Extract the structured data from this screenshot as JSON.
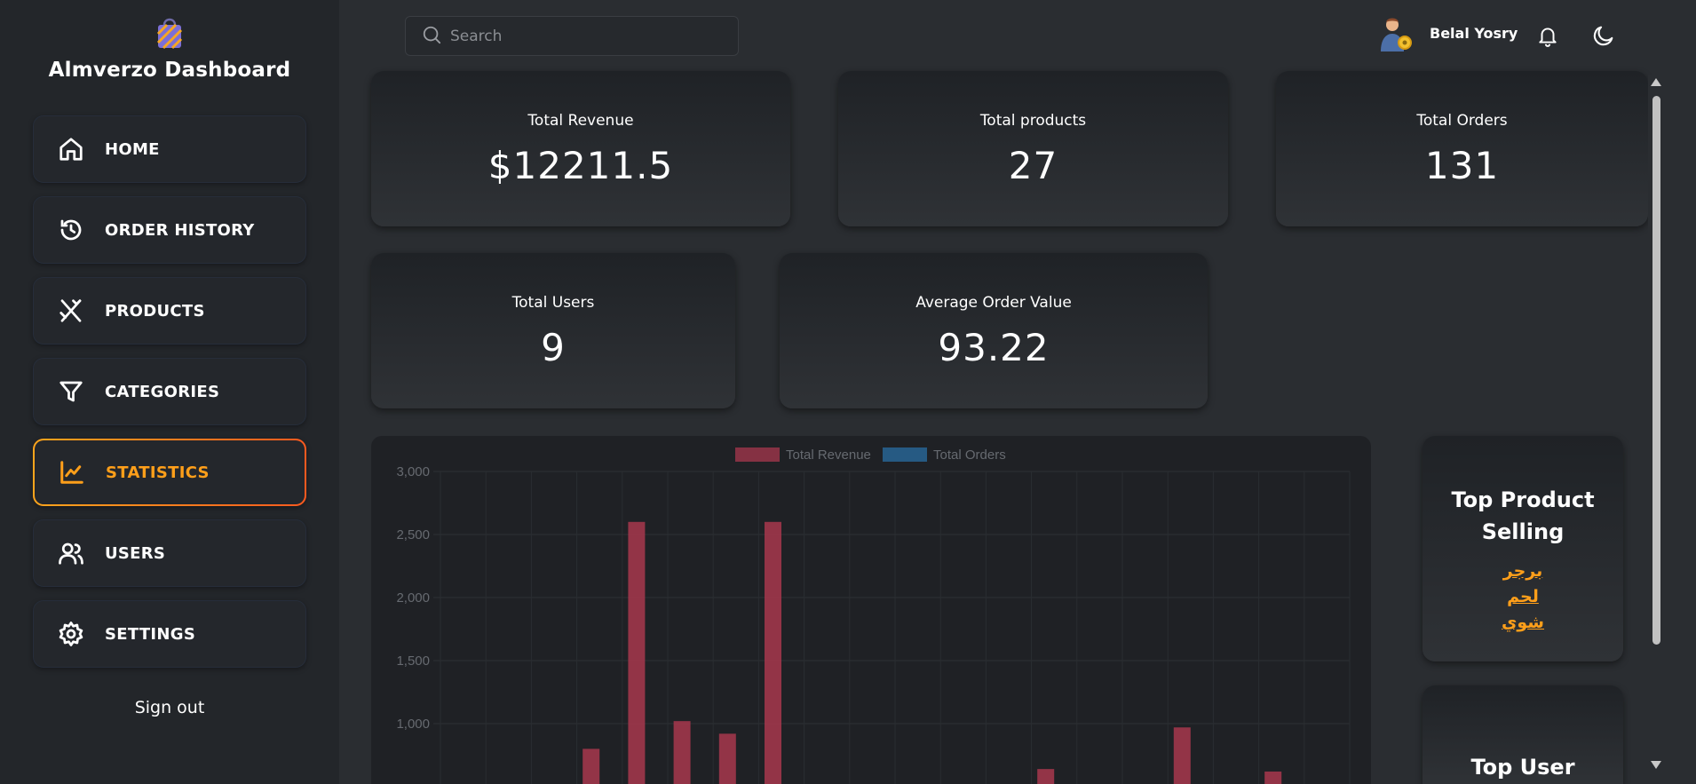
{
  "brand": {
    "title": "Almverzo Dashboard",
    "logo_icon": "shopping-bag-icon"
  },
  "sidebar": {
    "items": [
      {
        "label": "HOME",
        "icon": "home-icon",
        "active": false
      },
      {
        "label": "ORDER HISTORY",
        "icon": "history-icon",
        "active": false
      },
      {
        "label": "PRODUCTS",
        "icon": "utensils-icon",
        "active": false
      },
      {
        "label": "CATEGORIES",
        "icon": "filter-icon",
        "active": false
      },
      {
        "label": "STATISTICS",
        "icon": "chart-line-icon",
        "active": true
      },
      {
        "label": "USERS",
        "icon": "users-icon",
        "active": false
      },
      {
        "label": "SETTINGS",
        "icon": "gear-icon",
        "active": false
      }
    ],
    "sign_out": "Sign out"
  },
  "header": {
    "search_placeholder": "Search",
    "user_name": "Belal Yosry"
  },
  "stats": {
    "total_revenue": {
      "label": "Total Revenue",
      "value": "$12211.5"
    },
    "total_products": {
      "label": "Total products",
      "value": "27"
    },
    "total_orders": {
      "label": "Total Orders",
      "value": "131"
    },
    "total_users": {
      "label": "Total Users",
      "value": "9"
    },
    "avg_order_value": {
      "label": "Average Order Value",
      "value": "93.22"
    }
  },
  "top_products": {
    "title_line1": "Top Product",
    "title_line2": "Selling",
    "items": [
      "برجر",
      "لحم",
      "شوي"
    ]
  },
  "top_user": {
    "title": "Top User"
  },
  "colors": {
    "accent": "#ff9f1a",
    "revenue_bar": "#a8374d",
    "orders_bar": "#2a6da3",
    "sidebar_bg": "#23262a",
    "main_bg": "#2a2d31"
  },
  "chart_data": {
    "type": "bar",
    "legend": [
      "Total Revenue",
      "Total Orders"
    ],
    "legend_position": "top-center",
    "yticks": [
      "3,000",
      "2,500",
      "2,000",
      "1,500",
      "1,000"
    ],
    "ylim": [
      0,
      3000
    ],
    "grid": true,
    "series": [
      {
        "name": "Total Revenue",
        "values": [
          0,
          0,
          0,
          800,
          2600,
          1020,
          920,
          2600,
          0,
          0,
          0,
          0,
          0,
          640,
          0,
          0,
          970,
          0,
          620,
          0
        ]
      },
      {
        "name": "Total Orders",
        "values": [
          0,
          0,
          0,
          0,
          0,
          0,
          0,
          0,
          0,
          0,
          0,
          0,
          0,
          0,
          0,
          0,
          0,
          0,
          0,
          0
        ]
      }
    ]
  }
}
